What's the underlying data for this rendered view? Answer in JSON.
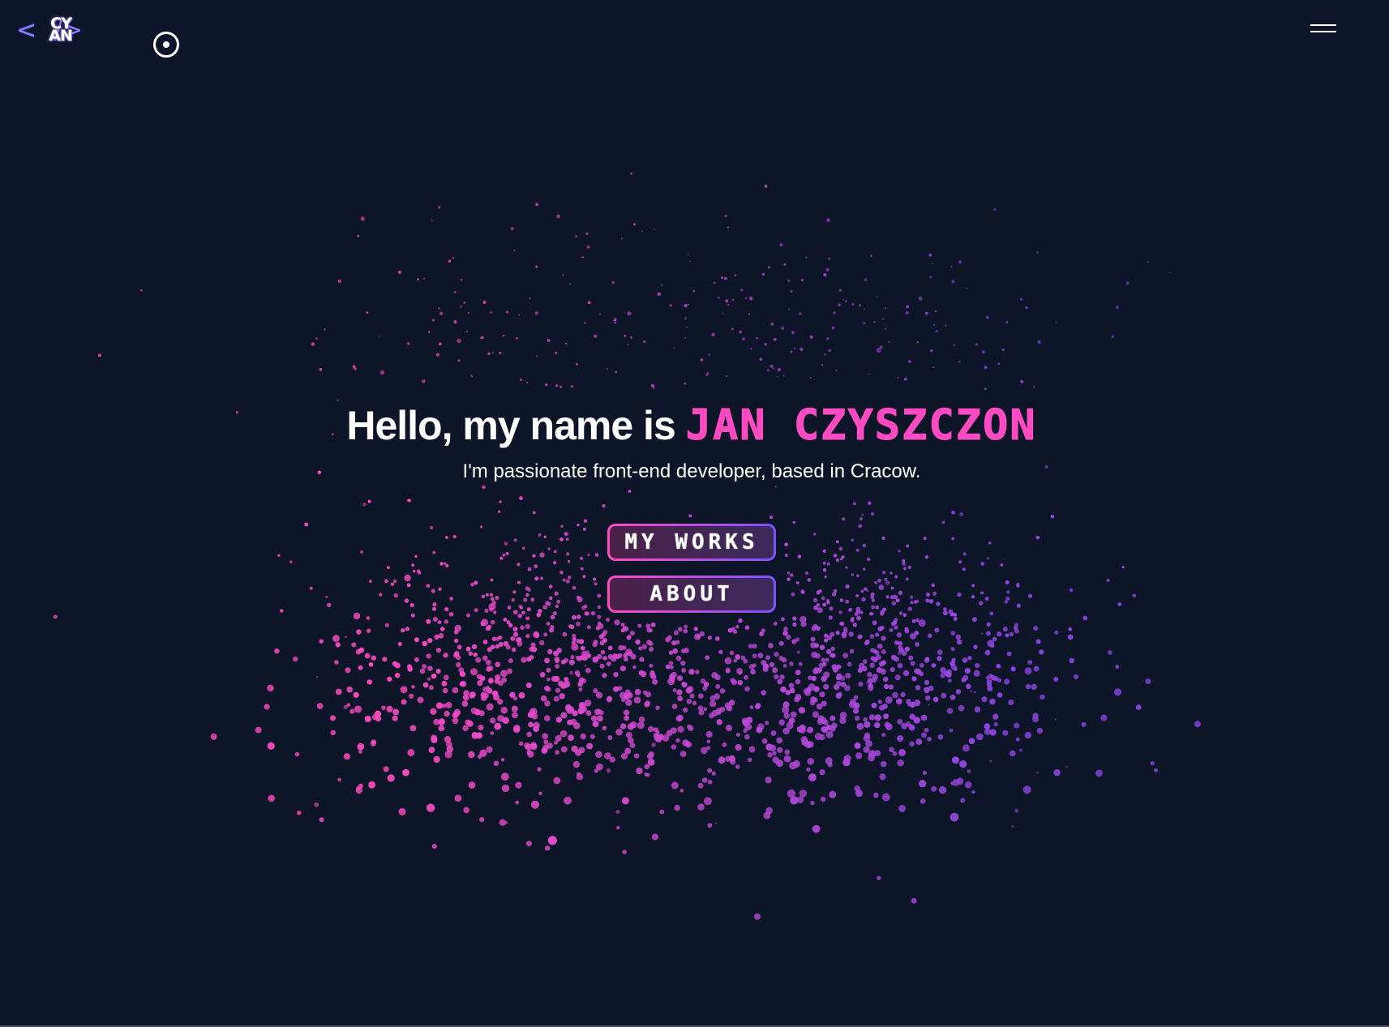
{
  "header": {
    "logo": {
      "left_bracket": "<",
      "line1": "CY",
      "line2": "AN",
      "right_bracket": "/>"
    },
    "icons": {
      "cursor": "target-circle-icon",
      "menu": "hamburger-menu-icon"
    }
  },
  "hero": {
    "greeting": "Hello, my name is ",
    "name": "JAN CZYSZCZON",
    "subtitle": "I'm passionate front-end developer, based in Cracow."
  },
  "buttons": {
    "works_label": "MY WORKS",
    "about_label": "ABOUT"
  },
  "colors": {
    "background": "#0e1528",
    "accent_pink": "#ff4bc1",
    "accent_purple": "#7b52ff"
  }
}
